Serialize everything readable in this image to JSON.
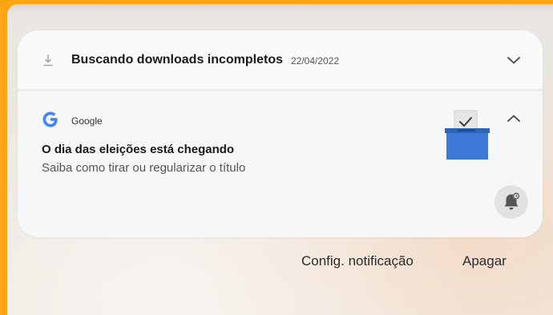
{
  "download_notification": {
    "icon": "download-icon",
    "title": "Buscando downloads incompletos",
    "date": "22/04/2022",
    "expand_icon": "chevron-down-icon"
  },
  "google_notification": {
    "app_icon": "google-g-icon",
    "app_name": "Google",
    "title": "O dia das eleições está chegando",
    "body": "Saiba como tirar ou regularizar o título",
    "image": "ballot-box-icon",
    "collapse_icon": "chevron-up-icon",
    "snooze_icon": "bell-snooze-icon"
  },
  "actions": {
    "settings_label": "Config. notificação",
    "clear_label": "Apagar"
  },
  "colors": {
    "frame": "#ffa412",
    "panel": "#f7f7f7",
    "ballot_blue": "#3d78d6",
    "google_blue": "#4285f4"
  }
}
